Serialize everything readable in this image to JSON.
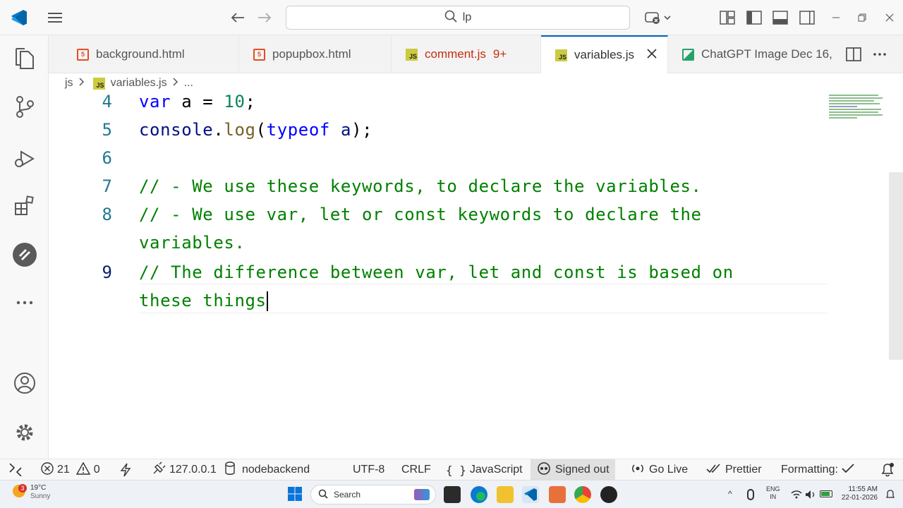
{
  "titlebar": {
    "search_text": "lp"
  },
  "tabs": [
    {
      "label": "background.html",
      "type": "html"
    },
    {
      "label": "popupbox.html",
      "type": "html"
    },
    {
      "label": "comment.js",
      "badge": "9+",
      "type": "js"
    },
    {
      "label": "variables.js",
      "type": "js",
      "active": true
    },
    {
      "label": "ChatGPT Image Dec 16,",
      "type": "image"
    }
  ],
  "breadcrumb": {
    "folder": "js",
    "file": "variables.js",
    "more": "..."
  },
  "editor": {
    "line_numbers": [
      "4",
      "5",
      "6",
      "7",
      "8",
      "9"
    ],
    "line4": {
      "kw": "var",
      "rest": " a = ",
      "num": "10",
      "end": ";"
    },
    "line5": {
      "obj": "console",
      "dot": ".",
      "fn": "log",
      "open": "(",
      "kw": "typeof",
      "sp": " ",
      "var": "a",
      "close": ");"
    },
    "line7": "// - We use these keywords, to declare the variables.",
    "line8a": "// - We use var, let or const keywords to declare the",
    "line8b": "variables.",
    "line9a": "// The difference between var, let and const is based on",
    "line9b": "these things"
  },
  "status": {
    "errors": "21",
    "warnings": "0",
    "host": "127.0.0.1",
    "db": "nodebackend",
    "encoding": "UTF-8",
    "eol": "CRLF",
    "language": "JavaScript",
    "account": "Signed out",
    "golive": "Go Live",
    "prettier": "Prettier",
    "formatting": "Formatting:"
  },
  "taskbar": {
    "weather_badge": "3",
    "temp": "19°C",
    "condition": "Sunny",
    "search": "Search",
    "lang1": "ENG",
    "lang2": "IN",
    "time": "11:55 AM",
    "date": "22-01-2026"
  },
  "colors": {
    "accent": "#0066b8",
    "comment": "#008000",
    "keyword": "#0000ff",
    "number": "#098658"
  }
}
